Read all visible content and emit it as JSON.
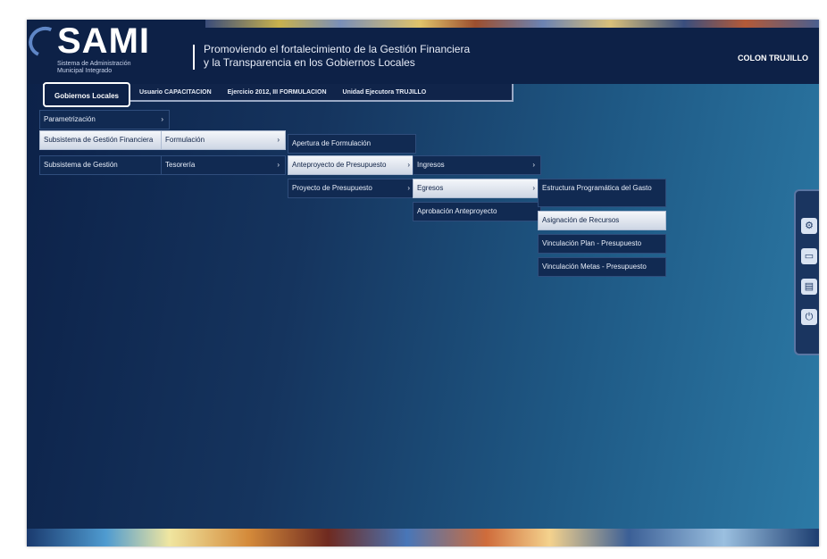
{
  "header": {
    "logo_title": "SAMI",
    "logo_subtitle": "Sistema de Administración Municipal Integrado",
    "tagline_line1": "Promoviendo el fortalecimiento de la Gestión Financiera",
    "tagline_line2": "y la Transparencia en los Gobiernos Locales",
    "user": "COLON TRUJILLO"
  },
  "info_bar": {
    "tab": "Gobiernos Locales",
    "usuario": "Usuario CAPACITACION",
    "ejercicio": "Ejercicio 2012, III FORMULACION",
    "unidad": "Unidad Ejecutora TRUJILLO"
  },
  "menu": {
    "level1": [
      "Parametrización",
      "Subsistema de Gestión Financiera",
      "Subsistema de Gestión"
    ],
    "level2": [
      "Formulación",
      "Tesorería"
    ],
    "level3": [
      "Apertura de Formulación",
      "Anteproyecto de Presupuesto",
      "Proyecto de Presupuesto"
    ],
    "level4": [
      "Ingresos",
      "Egresos",
      "Aprobación Anteproyecto"
    ],
    "level5": [
      "Estructura Programática del Gasto",
      "Asignación de Recursos",
      "Vinculación Plan - Presupuesto",
      "Vinculación Metas - Presupuesto"
    ]
  },
  "side_icons": [
    "settings-icon",
    "folder-icon",
    "document-icon",
    "power-icon"
  ],
  "colors": {
    "header_bg": "#0d2147",
    "menu_bg": "#112a52",
    "active_bg": "#e6ebf3"
  }
}
